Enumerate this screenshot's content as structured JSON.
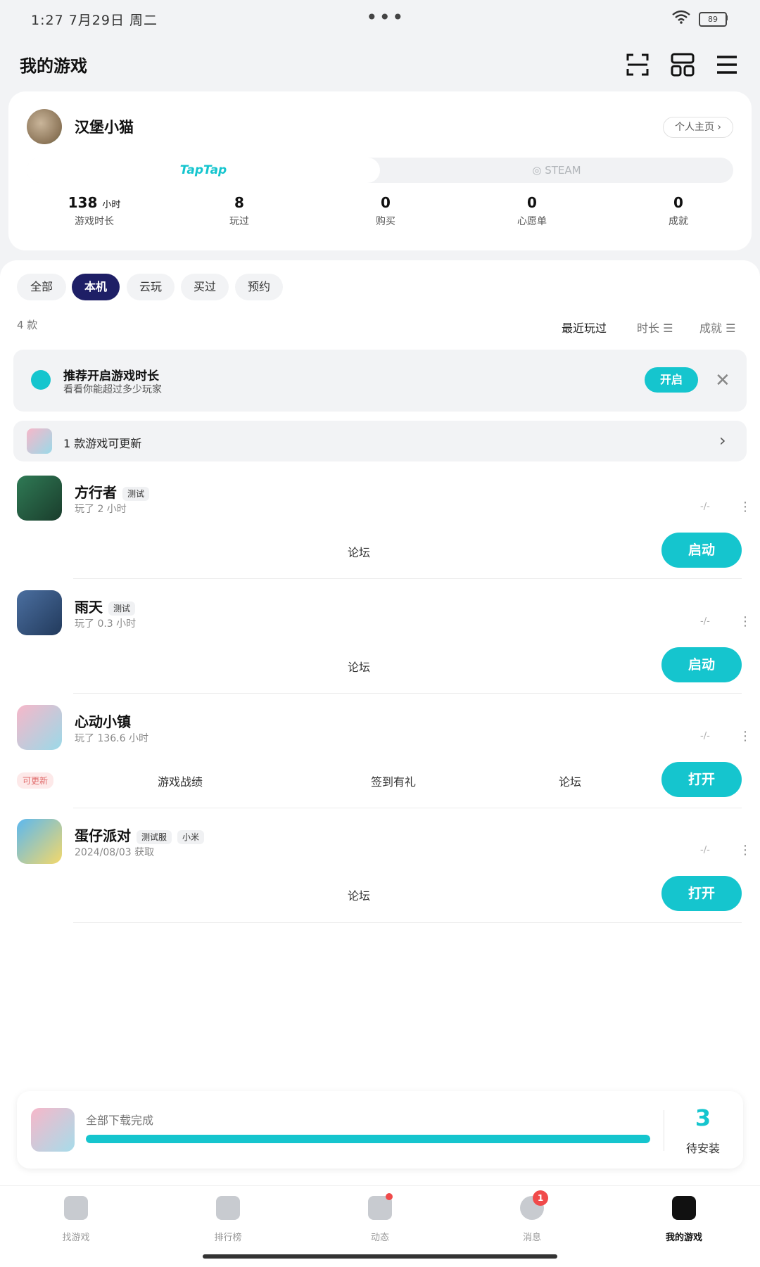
{
  "status_bar": {
    "time": "1:27  7月29日 周二",
    "battery": "89"
  },
  "header": {
    "title": "我的游戏"
  },
  "profile": {
    "username": "汉堡小猫",
    "home_link": "个人主页 ›",
    "platform_tabs": [
      "TapTap",
      "STEAM"
    ],
    "stats": [
      {
        "value": "138",
        "unit": "小时",
        "label": "游戏时长"
      },
      {
        "value": "8",
        "unit": "",
        "label": "玩过"
      },
      {
        "value": "0",
        "unit": "",
        "label": "购买"
      },
      {
        "value": "0",
        "unit": "",
        "label": "心愿单"
      },
      {
        "value": "0",
        "unit": "",
        "label": "成就"
      }
    ]
  },
  "filters": {
    "chips": [
      "全部",
      "本机",
      "云玩",
      "买过",
      "预约"
    ],
    "active": "本机"
  },
  "list_meta": {
    "count": "4 款",
    "sort_options": [
      "最近玩过",
      "时长 ☰",
      "成就 ☰"
    ]
  },
  "banner": {
    "title": "推荐开启游戏时长",
    "subtitle": "看看你能超过多少玩家",
    "button": "开启",
    "close": "✕"
  },
  "update_row": {
    "text": "1 款游戏可更新",
    "arrow": "›"
  },
  "games": [
    {
      "name": "方行者",
      "tags": [
        "测试"
      ],
      "sub": "玩了 2 小时",
      "meta": "-/-",
      "more": "⋮",
      "links": [
        "论坛"
      ],
      "button": "启动",
      "update_badge": "",
      "icon_color": "#2f7a55"
    },
    {
      "name": "雨天",
      "tags": [
        "测试"
      ],
      "sub": "玩了 0.3 小时",
      "meta": "-/-",
      "more": "⋮",
      "links": [
        "论坛"
      ],
      "button": "启动",
      "update_badge": "",
      "icon_color": "#3d5e8a"
    },
    {
      "name": "心动小镇",
      "tags": [],
      "sub": "玩了 136.6 小时",
      "meta": "-/-",
      "more": "⋮",
      "links": [
        "游戏战绩",
        "签到有礼",
        "论坛"
      ],
      "button": "打开",
      "update_badge": "可更新",
      "icon_color": "#f2a4b8"
    },
    {
      "name": "蛋仔派对",
      "tags": [
        "测试服",
        "小米"
      ],
      "sub": "2024/08/03 获取",
      "meta": "-/-",
      "more": "⋮",
      "links": [
        "论坛"
      ],
      "button": "打开",
      "update_badge": "",
      "icon_color": "#4aa6e0"
    }
  ],
  "download": {
    "text": "全部下载完成",
    "count": "3",
    "label": "待安装",
    "progress": 1.0
  },
  "nav": {
    "items": [
      "找游戏",
      "排行榜",
      "动态",
      "消息",
      "我的游戏"
    ],
    "active": "我的游戏",
    "message_badge": "1"
  },
  "colors": {
    "accent": "#15c5ce",
    "active_chip": "#1e1f66",
    "badge": "#f04a4a"
  }
}
